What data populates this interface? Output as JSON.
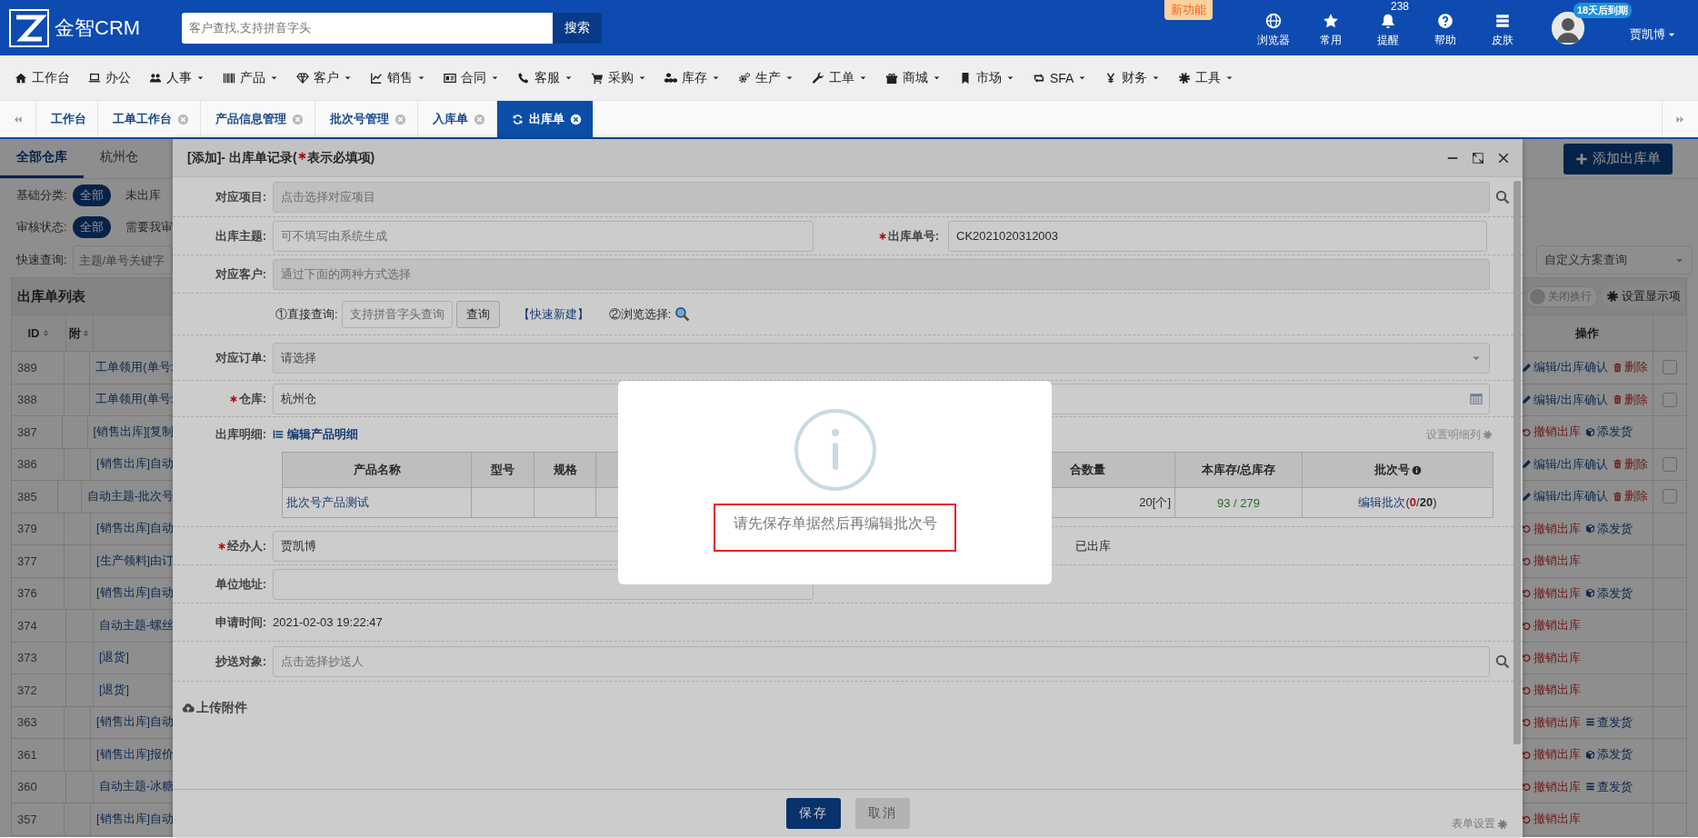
{
  "header": {
    "logo_text": "金智CRM",
    "search": {
      "placeholder": "客户查找,支持拼音字头"
    },
    "search_button": "搜索",
    "new_badge": "新功能",
    "tools": [
      {
        "label": "浏览器"
      },
      {
        "label": "常用"
      },
      {
        "label": "提醒",
        "badge": "238"
      },
      {
        "label": "帮助"
      },
      {
        "label": "皮肤"
      }
    ],
    "user": {
      "expiry_badge": "18天后到期",
      "name": "贾凯博"
    }
  },
  "menu": [
    {
      "label": "工作台",
      "dropdown": false
    },
    {
      "label": "办公",
      "dropdown": false
    },
    {
      "label": "人事",
      "dropdown": true
    },
    {
      "label": "产品",
      "dropdown": true
    },
    {
      "label": "客户",
      "dropdown": true
    },
    {
      "label": "销售",
      "dropdown": true
    },
    {
      "label": "合同",
      "dropdown": true
    },
    {
      "label": "客服",
      "dropdown": true
    },
    {
      "label": "采购",
      "dropdown": true
    },
    {
      "label": "库存",
      "dropdown": true
    },
    {
      "label": "生产",
      "dropdown": true
    },
    {
      "label": "工单",
      "dropdown": true
    },
    {
      "label": "商城",
      "dropdown": true
    },
    {
      "label": "市场",
      "dropdown": true
    },
    {
      "label": "SFA",
      "dropdown": true
    },
    {
      "label": "财务",
      "dropdown": true
    },
    {
      "label": "工具",
      "dropdown": true
    }
  ],
  "tabs": [
    {
      "label": "工作台",
      "selected": false,
      "closable": false
    },
    {
      "label": "工单工作台",
      "selected": false,
      "closable": true
    },
    {
      "label": "产品信息管理",
      "selected": false,
      "closable": true
    },
    {
      "label": "批次号管理",
      "selected": false,
      "closable": true
    },
    {
      "label": "入库单",
      "selected": false,
      "closable": true
    },
    {
      "label": "出库单",
      "selected": true,
      "closable": true
    }
  ],
  "page": {
    "warehouse_tabs": [
      {
        "label": "全部仓库",
        "selected": true
      },
      {
        "label": "杭州仓",
        "selected": false
      }
    ],
    "filters": [
      {
        "label": "基础分类:",
        "options": [
          {
            "label": "全部",
            "selected": true
          },
          {
            "label": "未出库",
            "selected": false
          }
        ]
      },
      {
        "label": "审核状态:",
        "options": [
          {
            "label": "全部",
            "selected": true
          },
          {
            "label": "需要我审",
            "selected": false
          }
        ]
      }
    ],
    "quick_search": {
      "label": "快速查询:",
      "placeholder": "主题/单号关键字"
    },
    "add_button": "添加出库单",
    "scheme_select": "自定义方案查询",
    "wrap_toggle": {
      "label": "关闭换行",
      "on": false
    },
    "display_button": "设置显示项",
    "table": {
      "title": "出库单列表",
      "columns": [
        "ID",
        "附",
        "操作"
      ],
      "rows": [
        {
          "id": "389",
          "subject": "工单领用(单号:",
          "actions": [
            {
              "kind": "edit",
              "label": "编辑/出库确认"
            },
            {
              "kind": "delete",
              "label": "删除"
            }
          ],
          "checkbox": true,
          "checked": false
        },
        {
          "id": "388",
          "subject": "工单领用(单号:",
          "actions": [
            {
              "kind": "edit",
              "label": "编辑/出库确认"
            },
            {
              "kind": "delete",
              "label": "删除"
            }
          ],
          "checkbox": true,
          "checked": false
        },
        {
          "id": "387",
          "subject": "[销售出库][复制",
          "actions": [
            {
              "kind": "cancel",
              "label": "撤销出库"
            },
            {
              "kind": "add_ship",
              "label": "添发货"
            }
          ],
          "checkbox": false
        },
        {
          "id": "386",
          "subject": "[销售出库]自动",
          "actions": [
            {
              "kind": "edit",
              "label": "编辑/出库确认"
            },
            {
              "kind": "delete",
              "label": "删除"
            }
          ],
          "checkbox": true,
          "checked": false
        },
        {
          "id": "385",
          "subject": "自动主题-批次号",
          "actions": [
            {
              "kind": "edit",
              "label": "编辑/出库确认"
            },
            {
              "kind": "delete",
              "label": "删除"
            }
          ],
          "checkbox": true,
          "checked": false
        },
        {
          "id": "379",
          "subject": "[销售出库]自动",
          "actions": [
            {
              "kind": "cancel",
              "label": "撤销出库"
            },
            {
              "kind": "add_ship",
              "label": "添发货"
            }
          ],
          "checkbox": false
        },
        {
          "id": "377",
          "subject": "[生产领料]由订",
          "actions": [
            {
              "kind": "cancel",
              "label": "撤销出库"
            }
          ],
          "checkbox": false
        },
        {
          "id": "376",
          "subject": "[销售出库]自动",
          "actions": [
            {
              "kind": "cancel",
              "label": "撤销出库"
            },
            {
              "kind": "add_ship",
              "label": "添发货"
            }
          ],
          "checkbox": false
        },
        {
          "id": "374",
          "subject": "自动主题-螺丝",
          "actions": [
            {
              "kind": "cancel",
              "label": "撤销出库"
            }
          ],
          "checkbox": false
        },
        {
          "id": "373",
          "subject": "[退货]",
          "actions": [
            {
              "kind": "cancel",
              "label": "撤销出库"
            }
          ],
          "checkbox": false
        },
        {
          "id": "372",
          "subject": "[退货]",
          "actions": [
            {
              "kind": "cancel",
              "label": "撤销出库"
            }
          ],
          "checkbox": false
        },
        {
          "id": "363",
          "subject": "[销售出库]自动",
          "actions": [
            {
              "kind": "cancel",
              "label": "撤销出库"
            },
            {
              "kind": "view_ship",
              "label": "查发货"
            }
          ],
          "checkbox": false
        },
        {
          "id": "361",
          "subject": "[销售出库]报价",
          "actions": [
            {
              "kind": "cancel",
              "label": "撤销出库"
            },
            {
              "kind": "add_ship",
              "label": "添发货"
            }
          ],
          "checkbox": false
        },
        {
          "id": "360",
          "subject": "自动主题-冰糖",
          "actions": [
            {
              "kind": "cancel",
              "label": "撤销出库"
            },
            {
              "kind": "view_ship",
              "label": "查发货"
            }
          ],
          "checkbox": false
        },
        {
          "id": "357",
          "subject": "[销售出库]自动",
          "actions": [
            {
              "kind": "cancel",
              "label": "撤销出库"
            }
          ],
          "checkbox": false
        }
      ]
    }
  },
  "modal": {
    "title": "[添加]- 出库单记录(",
    "title_note": "表示必填项)",
    "form": [
      {
        "kind": "search_field",
        "label": "对应项目:",
        "required": false,
        "placeholder": "点击选择对应项目",
        "readonly": true
      },
      {
        "kind": "pair",
        "left": {
          "label": "出库主题:",
          "required": false,
          "placeholder": "可不填写由系统生成",
          "readonly": false
        },
        "right": {
          "label": "出库单号:",
          "required": true,
          "value": "CK2021020312003",
          "readonly": false
        }
      },
      {
        "kind": "wide_field",
        "label": "对应客户:",
        "required": false,
        "placeholder": "通过下面的两种方式选择",
        "readonly": true
      },
      {
        "kind": "lookup",
        "direct_label": "①直接查询:",
        "placeholder": "支持拼音字头查询",
        "query_button": "查询",
        "quick_new": "【快速新建】",
        "browse_label": "②浏览选择:"
      },
      {
        "kind": "select",
        "label": "对应订单:",
        "value": "请选择"
      },
      {
        "kind": "picker_field",
        "label": "仓库:",
        "required": true,
        "value": "杭州仓",
        "readonly": false
      },
      {
        "kind": "details",
        "label": "出库明细:",
        "edit_link": "编辑产品明细",
        "column_settings": "设置明细列",
        "columns": [
          "产品名称",
          "型号",
          "规格",
          "合数量",
          "本库存/总库存",
          "批次号"
        ],
        "rows": [
          {
            "name": "批次号产品测试",
            "quantity": "20[个]",
            "stock": "93 / 279",
            "batch_link": "编辑批次",
            "batch_count": "(**0**/**20**)"
          }
        ]
      },
      {
        "kind": "field",
        "label": "经办人:",
        "required": true,
        "value": "贾凯博",
        "readonly": false,
        "side_text": "已出库"
      },
      {
        "kind": "field",
        "label": "单位地址:",
        "required": false,
        "readonly": false
      },
      {
        "kind": "text",
        "label": "申请时间:",
        "value": "2021-02-03 19:22:47"
      },
      {
        "kind": "search_field",
        "label": "抄送对象:",
        "required": false,
        "placeholder": "点击选择抄送人",
        "readonly": false
      }
    ],
    "upload": "上传附件",
    "buttons": [
      {
        "label": "保存",
        "kind": "primary"
      },
      {
        "label": "取消",
        "kind": "default"
      }
    ],
    "form_settings": "表单设置"
  },
  "alert": {
    "message": "请先保存单据然后再编辑批次号"
  }
}
